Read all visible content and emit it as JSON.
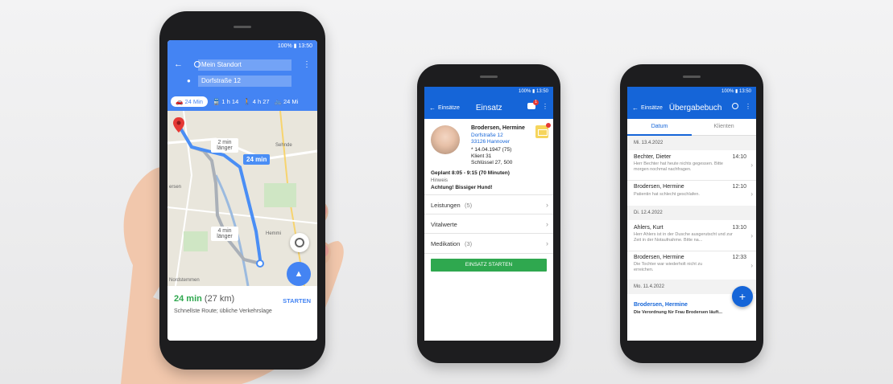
{
  "maps": {
    "status": "100% ▮ 13:50",
    "origin": "Mein Standort",
    "destination": "Dorfstraße 12",
    "modes": [
      {
        "icon": "car-icon",
        "label": "24 Min",
        "active": true
      },
      {
        "icon": "train-icon",
        "label": "1 h 14"
      },
      {
        "icon": "walk-icon",
        "label": "4 h 27"
      },
      {
        "icon": "bike-icon",
        "label": "24 Mi"
      }
    ],
    "map_labels": {
      "delay_1": "2 min länger",
      "eta_main": "24 min",
      "delay_2": "4 min länger",
      "place_1": "Sehnde",
      "place_2": "Hemmi",
      "place_3": "Nordstemmen",
      "place_4": "ersen"
    },
    "summary_time": "24 min",
    "summary_dist": "(27 km)",
    "summary_note": "Schnellste Route; übliche Verkehrslage",
    "start_label": "STARTEN"
  },
  "einsatz": {
    "status": "100% ▮ 13:50",
    "back_label": "Einsätze",
    "title": "Einsatz",
    "badge_count": "1",
    "name": "Brodersen, Hermine",
    "street": "Dorfstraße 12",
    "city": "33126 Hannover",
    "birth": "* 14.04.1947 (75)",
    "client": "Klient 31",
    "key": "Schlüssel 27, 500",
    "planned": "Geplant 8:05 - 9:15 (70 Minuten)",
    "hint_label": "Hinweis",
    "hint_text": "Achtung! Bissiger Hund!",
    "rows": [
      {
        "label": "Leistungen",
        "count": "(5)"
      },
      {
        "label": "Vitalwerte",
        "count": ""
      },
      {
        "label": "Medikation",
        "count": "(3)"
      }
    ],
    "start_button": "EINSATZ STARTEN"
  },
  "handover": {
    "status": "100% ▮ 13:50",
    "back_label": "Einsätze",
    "title": "Übergabebuch",
    "tabs": [
      "Datum",
      "Klienten"
    ],
    "groups": [
      {
        "date": "Mi. 13.4.2022",
        "entries": [
          {
            "name": "Bechter, Dieter",
            "time": "14:10",
            "text": "Herr Bechter hat heute nichts gegessen. Bitte morgen nochmal nachfragen."
          },
          {
            "name": "Brodersen, Hermine",
            "time": "12:10",
            "text": "Patientin hat schlecht geschlafen."
          }
        ]
      },
      {
        "date": "Di. 12.4.2022",
        "entries": [
          {
            "name": "Ahlers, Kurt",
            "time": "13:10",
            "text": "Herr Ahlers ist in der Dusche ausgerutscht und zur Zeit in der Notaufnahme. Bitte na..."
          },
          {
            "name": "Brodersen, Hermine",
            "time": "12:33",
            "text": "Die Tochter war wiederholt nicht zu erreichen."
          }
        ]
      },
      {
        "date": "Mo. 11.4.2022",
        "entries": [
          {
            "name": "Brodersen, Hermine",
            "time": "",
            "text": "Die Verordnung für Frau Brodersen läuft..."
          }
        ]
      }
    ],
    "fab": "+"
  },
  "colors": {
    "maps_blue": "#4484f3",
    "app_blue": "#1565d8",
    "green": "#2fa84f",
    "route": "#4a8ef5"
  }
}
